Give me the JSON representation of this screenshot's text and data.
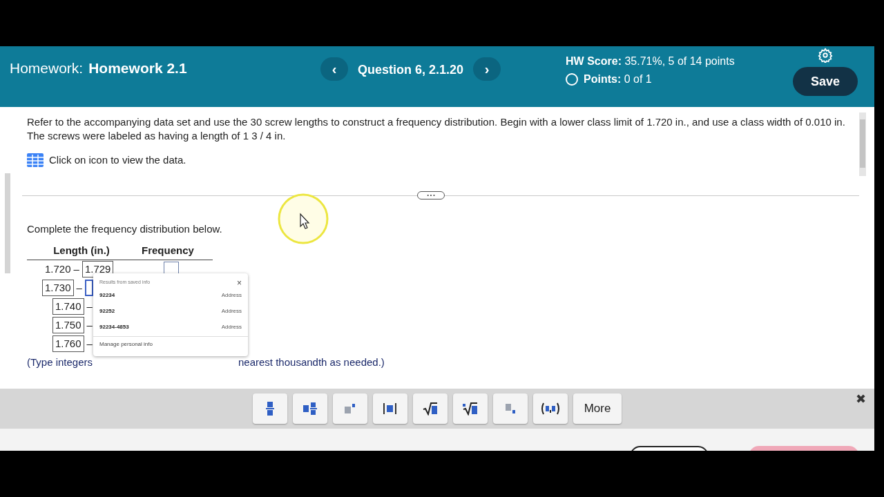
{
  "header": {
    "label": "Homework:",
    "title": "Homework 2.1",
    "prev": "‹",
    "question": "Question 6, 2.1.20",
    "next": "›",
    "score_label": "HW Score:",
    "score": "35.71%, 5 of 14 points",
    "points_label": "Points:",
    "points": "0 of 1",
    "points_done": false,
    "save": "Save"
  },
  "problem": {
    "text": "Refer to the accompanying data set and use the 30 screw lengths to construct a frequency distribution. Begin with a lower class limit of 1.720 in., and use a class width of 0.010 in. The screws were labeled as having a length of 1 3 / 4 in.",
    "data_link": "Click on icon to view the data.",
    "divider_handle": "• • •"
  },
  "answer": {
    "prompt": "Complete the frequency distribution below.",
    "columns": [
      "Length (in.)",
      "Frequency"
    ],
    "rows": [
      {
        "lower": "1.720",
        "lower_editable": false,
        "dash": "–",
        "upper": "1.729",
        "focused": false
      },
      {
        "lower": "1.730",
        "lower_editable": true,
        "dash": "–",
        "focused": true
      },
      {
        "lower": "1.740",
        "lower_editable": true,
        "dash": "–"
      },
      {
        "lower": "1.750",
        "lower_editable": true,
        "dash": "–"
      },
      {
        "lower": "1.760",
        "lower_editable": true,
        "dash": "–"
      }
    ],
    "hint_start": "(Type integers",
    "hint_end": "nearest thousandth as needed.)"
  },
  "autofill": {
    "title": "Results from saved info",
    "close": "×",
    "items": [
      {
        "value": "92234",
        "type": "Address"
      },
      {
        "value": "92252",
        "type": "Address"
      },
      {
        "value": "92234-4853",
        "type": "Address"
      }
    ],
    "manage": "Manage personal info"
  },
  "toolbar": {
    "tools": [
      {
        "kind": "fraction"
      },
      {
        "kind": "mixed"
      },
      {
        "kind": "exponent"
      },
      {
        "kind": "abs"
      },
      {
        "kind": "sqrt"
      },
      {
        "kind": "nroot"
      },
      {
        "kind": "subscript"
      },
      {
        "kind": "point"
      }
    ],
    "more": "More",
    "close": "✖"
  }
}
